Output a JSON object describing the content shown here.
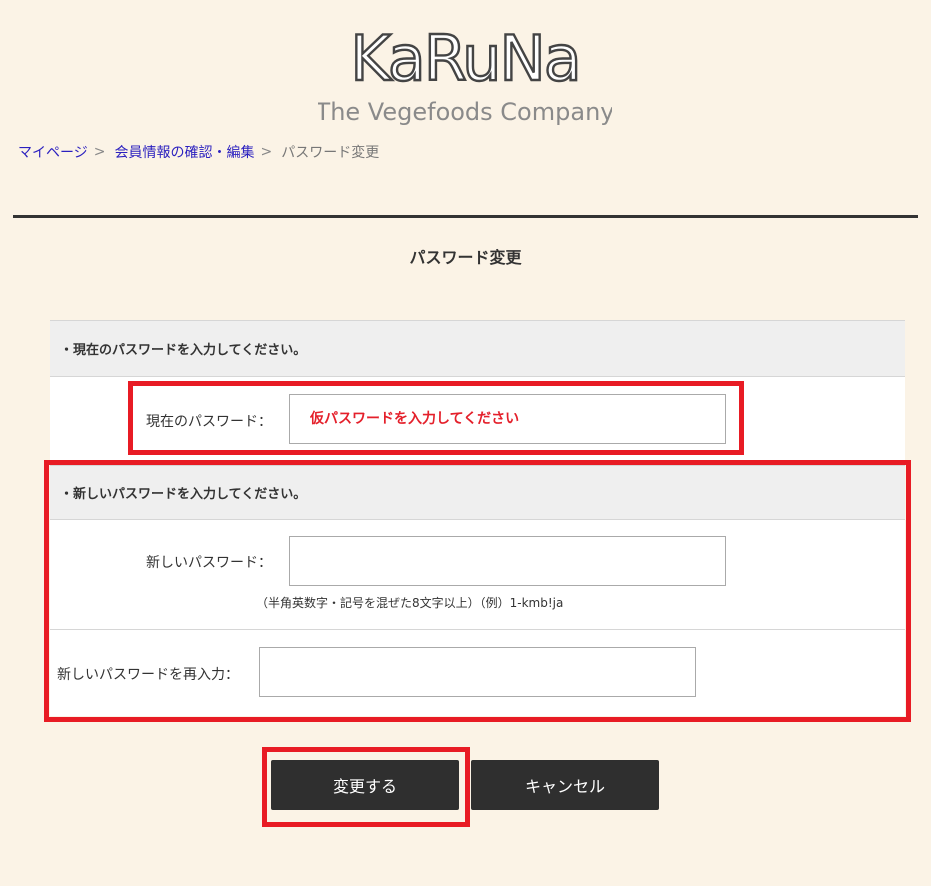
{
  "logo": {
    "mark": "KaRuNa",
    "tagline": "The Vegefoods Company"
  },
  "breadcrumb": [
    {
      "label": "マイページ",
      "sep": ">"
    },
    {
      "label": "会員情報の確認・編集",
      "sep": ">"
    },
    {
      "label": "パスワード変更"
    }
  ],
  "page_title": "パスワード変更",
  "current_section": {
    "heading": "・現在のパスワードを入力してください。",
    "label": "現在のパスワード：",
    "placeholder": "仮パスワードを入力してください",
    "value": ""
  },
  "new_section": {
    "heading": "・新しいパスワードを入力してください。",
    "new_label": "新しいパスワード：",
    "new_value": "",
    "hint": "（半角英数字・記号を混ぜた8文字以上）（例）1-kmb!ja",
    "confirm_label": "新しいパスワードを再入力：",
    "confirm_value": ""
  },
  "buttons": {
    "submit": "変更する",
    "cancel": "キャンセル"
  },
  "colors": {
    "background": "#fbf3e6",
    "highlight": "#e81b24",
    "link": "#2a1fbf",
    "button": "#2f2f2f"
  }
}
